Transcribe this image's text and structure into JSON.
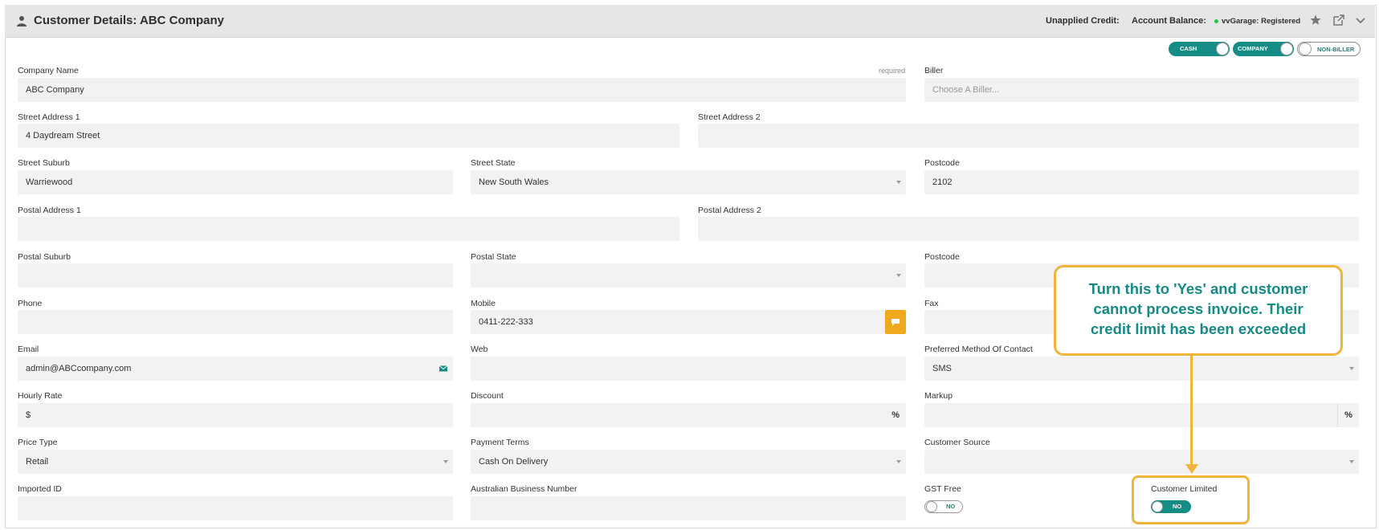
{
  "header": {
    "title": "Customer Details: ABC Company",
    "unapplied_credit": "Unapplied Credit:",
    "account_balance": "Account Balance:",
    "vvgarage_status": "vvGarage: Registered"
  },
  "pills": {
    "cash": "CASH",
    "company": "COMPANY",
    "non_biller": "NON-BILLER"
  },
  "fields": {
    "company_name": {
      "label": "Company Name",
      "required": "required",
      "value": "ABC Company"
    },
    "biller": {
      "label": "Biller",
      "placeholder": "Choose A Biller..."
    },
    "street_address_1": {
      "label": "Street Address 1",
      "value": "4 Daydream Street"
    },
    "street_address_2": {
      "label": "Street Address 2",
      "value": ""
    },
    "street_suburb": {
      "label": "Street Suburb",
      "value": "Warriewood"
    },
    "street_state": {
      "label": "Street State",
      "value": "New South Wales"
    },
    "street_postcode": {
      "label": "Postcode",
      "value": "2102"
    },
    "postal_address_1": {
      "label": "Postal Address 1",
      "value": ""
    },
    "postal_address_2": {
      "label": "Postal Address 2",
      "value": ""
    },
    "postal_suburb": {
      "label": "Postal Suburb",
      "value": ""
    },
    "postal_state": {
      "label": "Postal State",
      "value": ""
    },
    "postal_postcode": {
      "label": "Postcode",
      "value": ""
    },
    "phone": {
      "label": "Phone",
      "value": ""
    },
    "mobile": {
      "label": "Mobile",
      "value": "0411-222-333"
    },
    "fax": {
      "label": "Fax",
      "value": ""
    },
    "email": {
      "label": "Email",
      "value": "admin@ABCcompany.com"
    },
    "web": {
      "label": "Web",
      "value": ""
    },
    "preferred_contact": {
      "label": "Preferred Method Of Contact",
      "value": "SMS"
    },
    "hourly_rate": {
      "label": "Hourly Rate",
      "value": "$"
    },
    "discount": {
      "label": "Discount",
      "value": "",
      "suffix": "%"
    },
    "markup": {
      "label": "Markup",
      "value": "",
      "suffix": "%"
    },
    "price_type": {
      "label": "Price Type",
      "value": "Retail"
    },
    "payment_terms": {
      "label": "Payment Terms",
      "value": "Cash On Delivery"
    },
    "customer_source": {
      "label": "Customer Source",
      "value": ""
    },
    "imported_id": {
      "label": "Imported ID",
      "value": ""
    },
    "abn": {
      "label": "Australian Business Number",
      "value": ""
    },
    "gst_free": {
      "label": "GST Free",
      "state": "NO"
    },
    "customer_limited": {
      "label": "Customer Limited",
      "state": "NO"
    }
  },
  "callout": {
    "line1": "Turn this to 'Yes' and customer",
    "line2": "cannot process invoice. Their",
    "line3": "credit limit has been exceeded"
  },
  "colors": {
    "teal": "#168c86",
    "orange": "#f0b43a",
    "field_bg": "#f2f2f2",
    "header_bg": "#e6e6e6"
  }
}
